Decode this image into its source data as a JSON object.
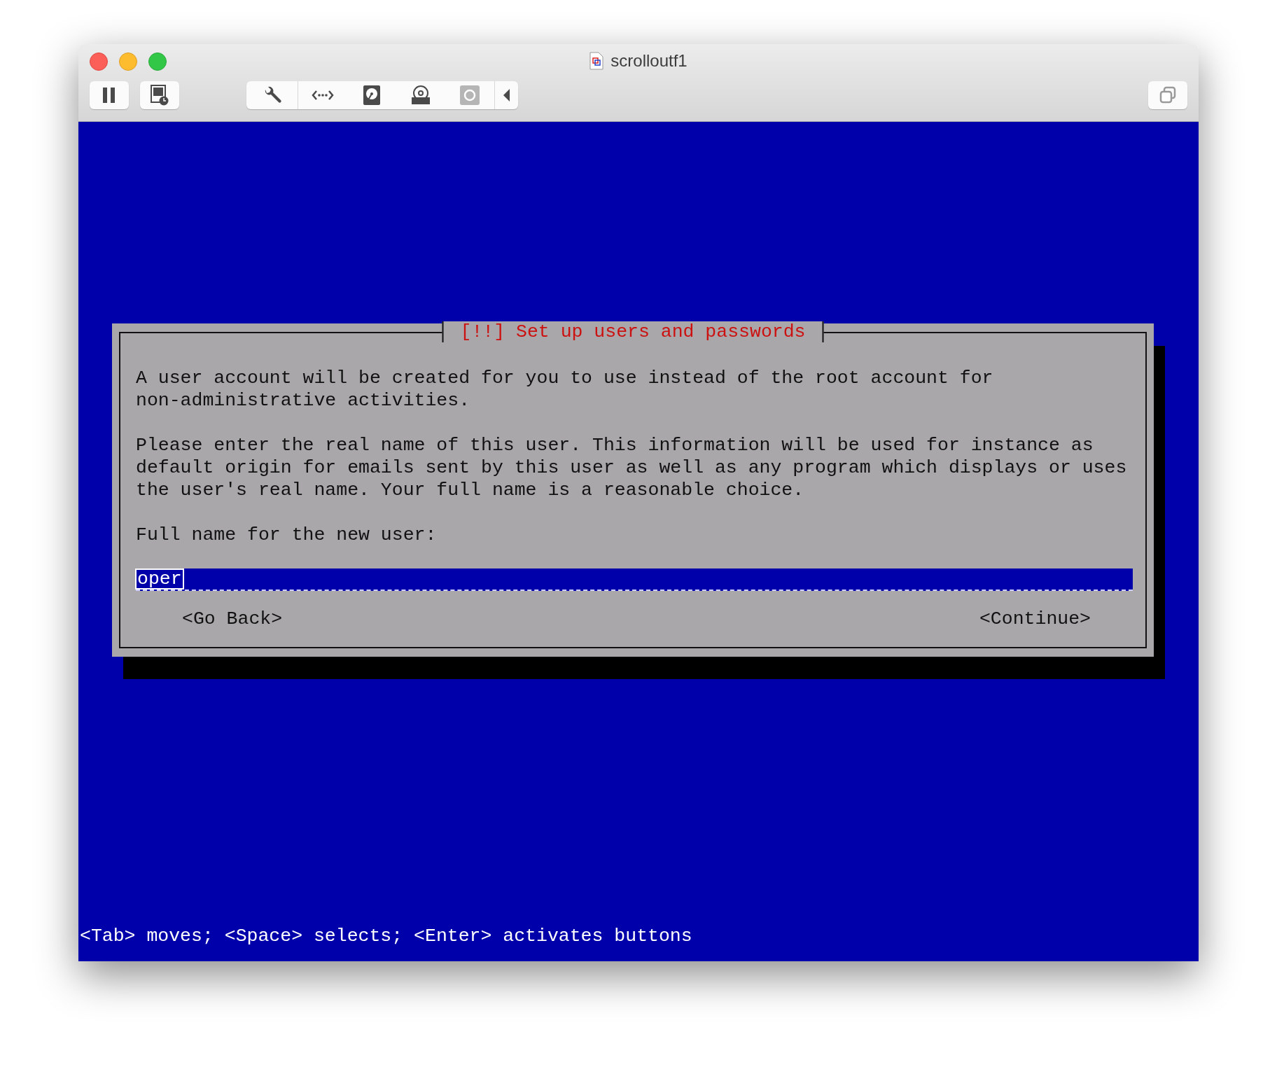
{
  "window": {
    "title": "scrolloutf1"
  },
  "dialog": {
    "title": "[!!] Set up users and passwords",
    "paragraphs": [
      "A user account will be created for you to use instead of the root account for\nnon-administrative activities.",
      "Please enter the real name of this user. This information will be used for instance as\ndefault origin for emails sent by this user as well as any program which displays or uses\nthe user's real name. Your full name is a reasonable choice."
    ],
    "prompt": "Full name for the new user:",
    "field": {
      "value": "oper"
    },
    "buttons": [
      "<Go Back>",
      "<Continue>"
    ]
  },
  "status_bar": "<Tab> moves; <Space> selects; <Enter> activates buttons"
}
